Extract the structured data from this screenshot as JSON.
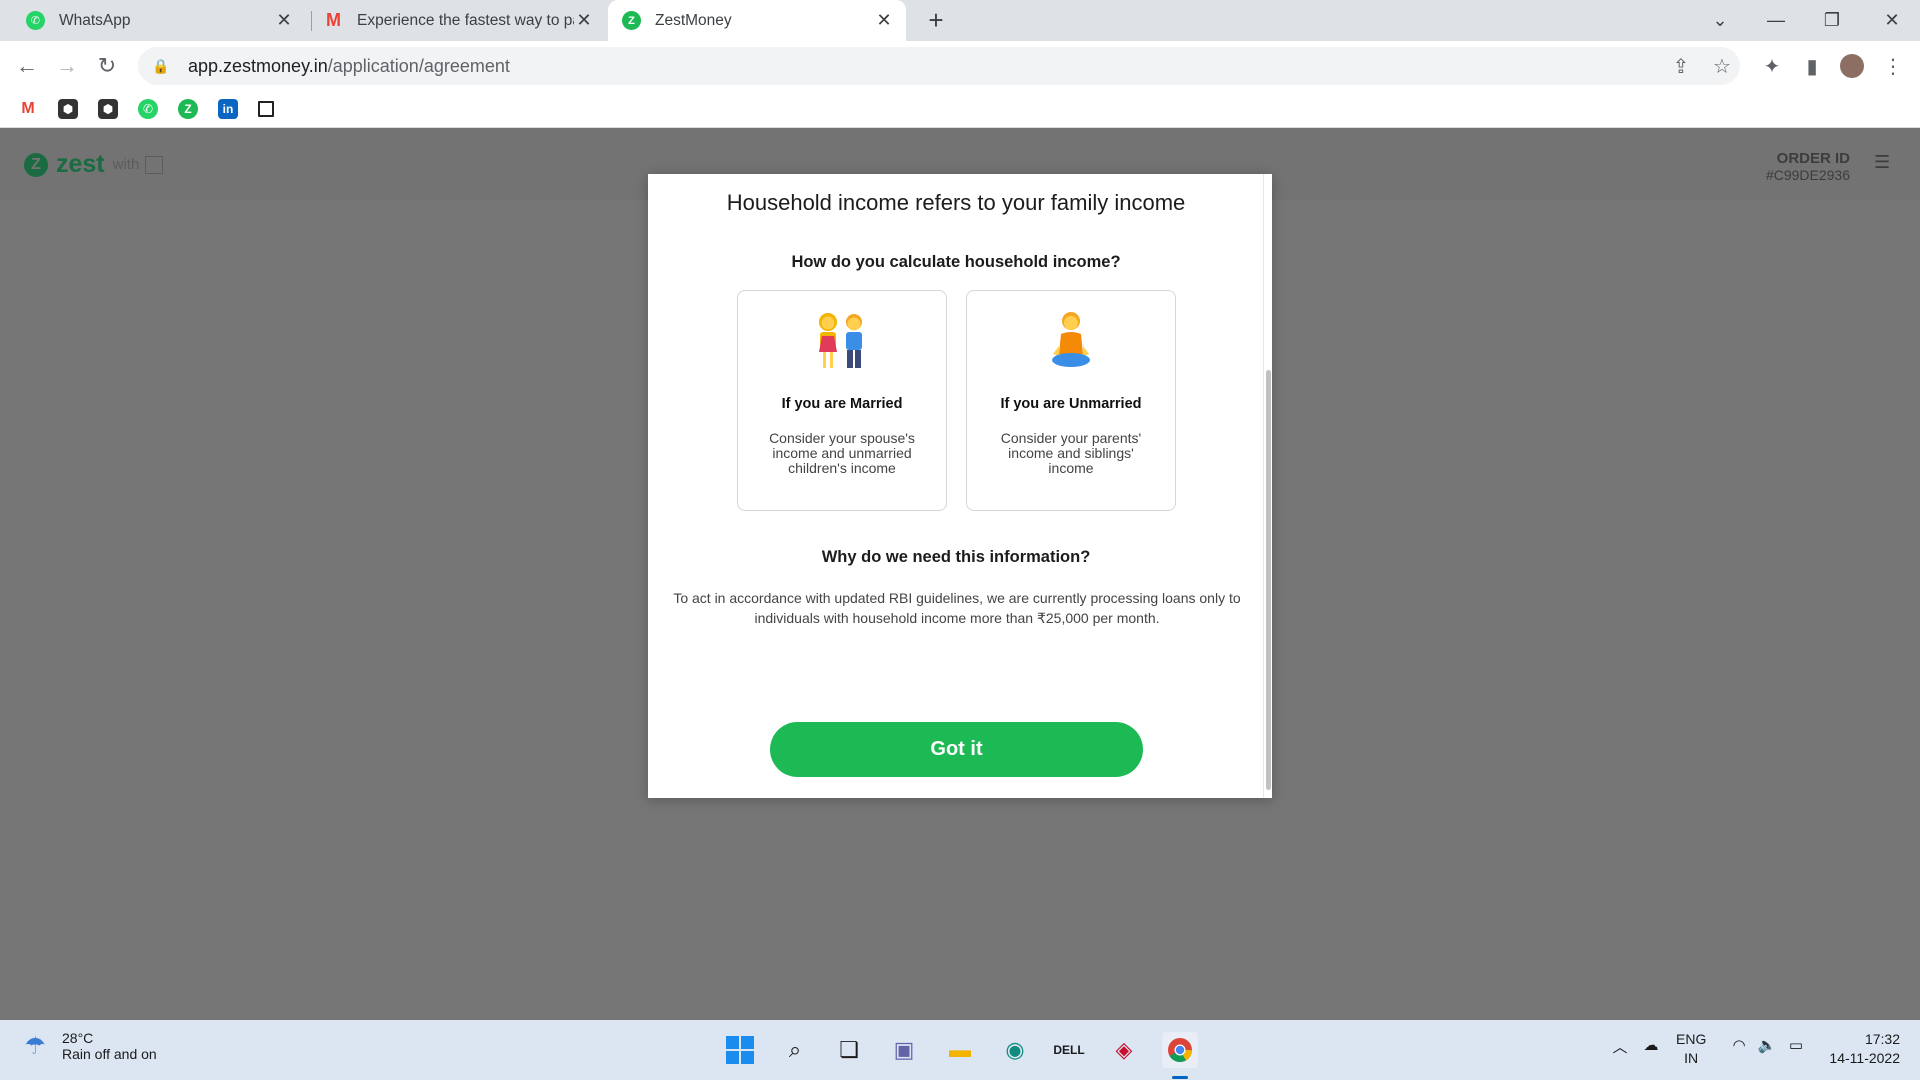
{
  "browser": {
    "tabs": [
      {
        "title": "WhatsApp",
        "icon": "whatsapp-icon",
        "color": "#25d366"
      },
      {
        "title": "Experience the fastest way to pay",
        "icon": "gmail-icon",
        "color": "#ea4335"
      },
      {
        "title": "ZestMoney",
        "icon": "zestmoney-icon",
        "color": "#1db954"
      }
    ],
    "url_host": "app.zestmoney.in",
    "url_path": "/application/agreement",
    "bookmarks": [
      "gmail-icon",
      "extension-icon",
      "extension-icon",
      "whatsapp-icon",
      "zest-icon",
      "linkedin-icon",
      "square-icon"
    ]
  },
  "page": {
    "logo_text": "zest",
    "logo_with": "with",
    "order_label": "ORDER ID",
    "order_value": "#C99DE2936"
  },
  "modal": {
    "title": "Household income refers to your family income",
    "question": "How do you calculate household income?",
    "cards": [
      {
        "title": "If you are Married",
        "desc": "Consider your spouse's income and unmarried children's income",
        "icon": "couple-icon"
      },
      {
        "title": "If you are Unmarried",
        "desc": "Consider your parents' income and siblings' income",
        "icon": "meditating-person-icon"
      }
    ],
    "why_heading": "Why do we need this information?",
    "why_text": "To act in accordance with updated RBI guidelines, we are currently processing loans only to individuals with household income more than ₹25,000 per month.",
    "button": "Got it",
    "accent": "#1db954"
  },
  "taskbar": {
    "temp": "28°C",
    "weather": "Rain off and on",
    "lang1": "ENG",
    "lang2": "IN",
    "time": "17:32",
    "date": "14-11-2022"
  }
}
